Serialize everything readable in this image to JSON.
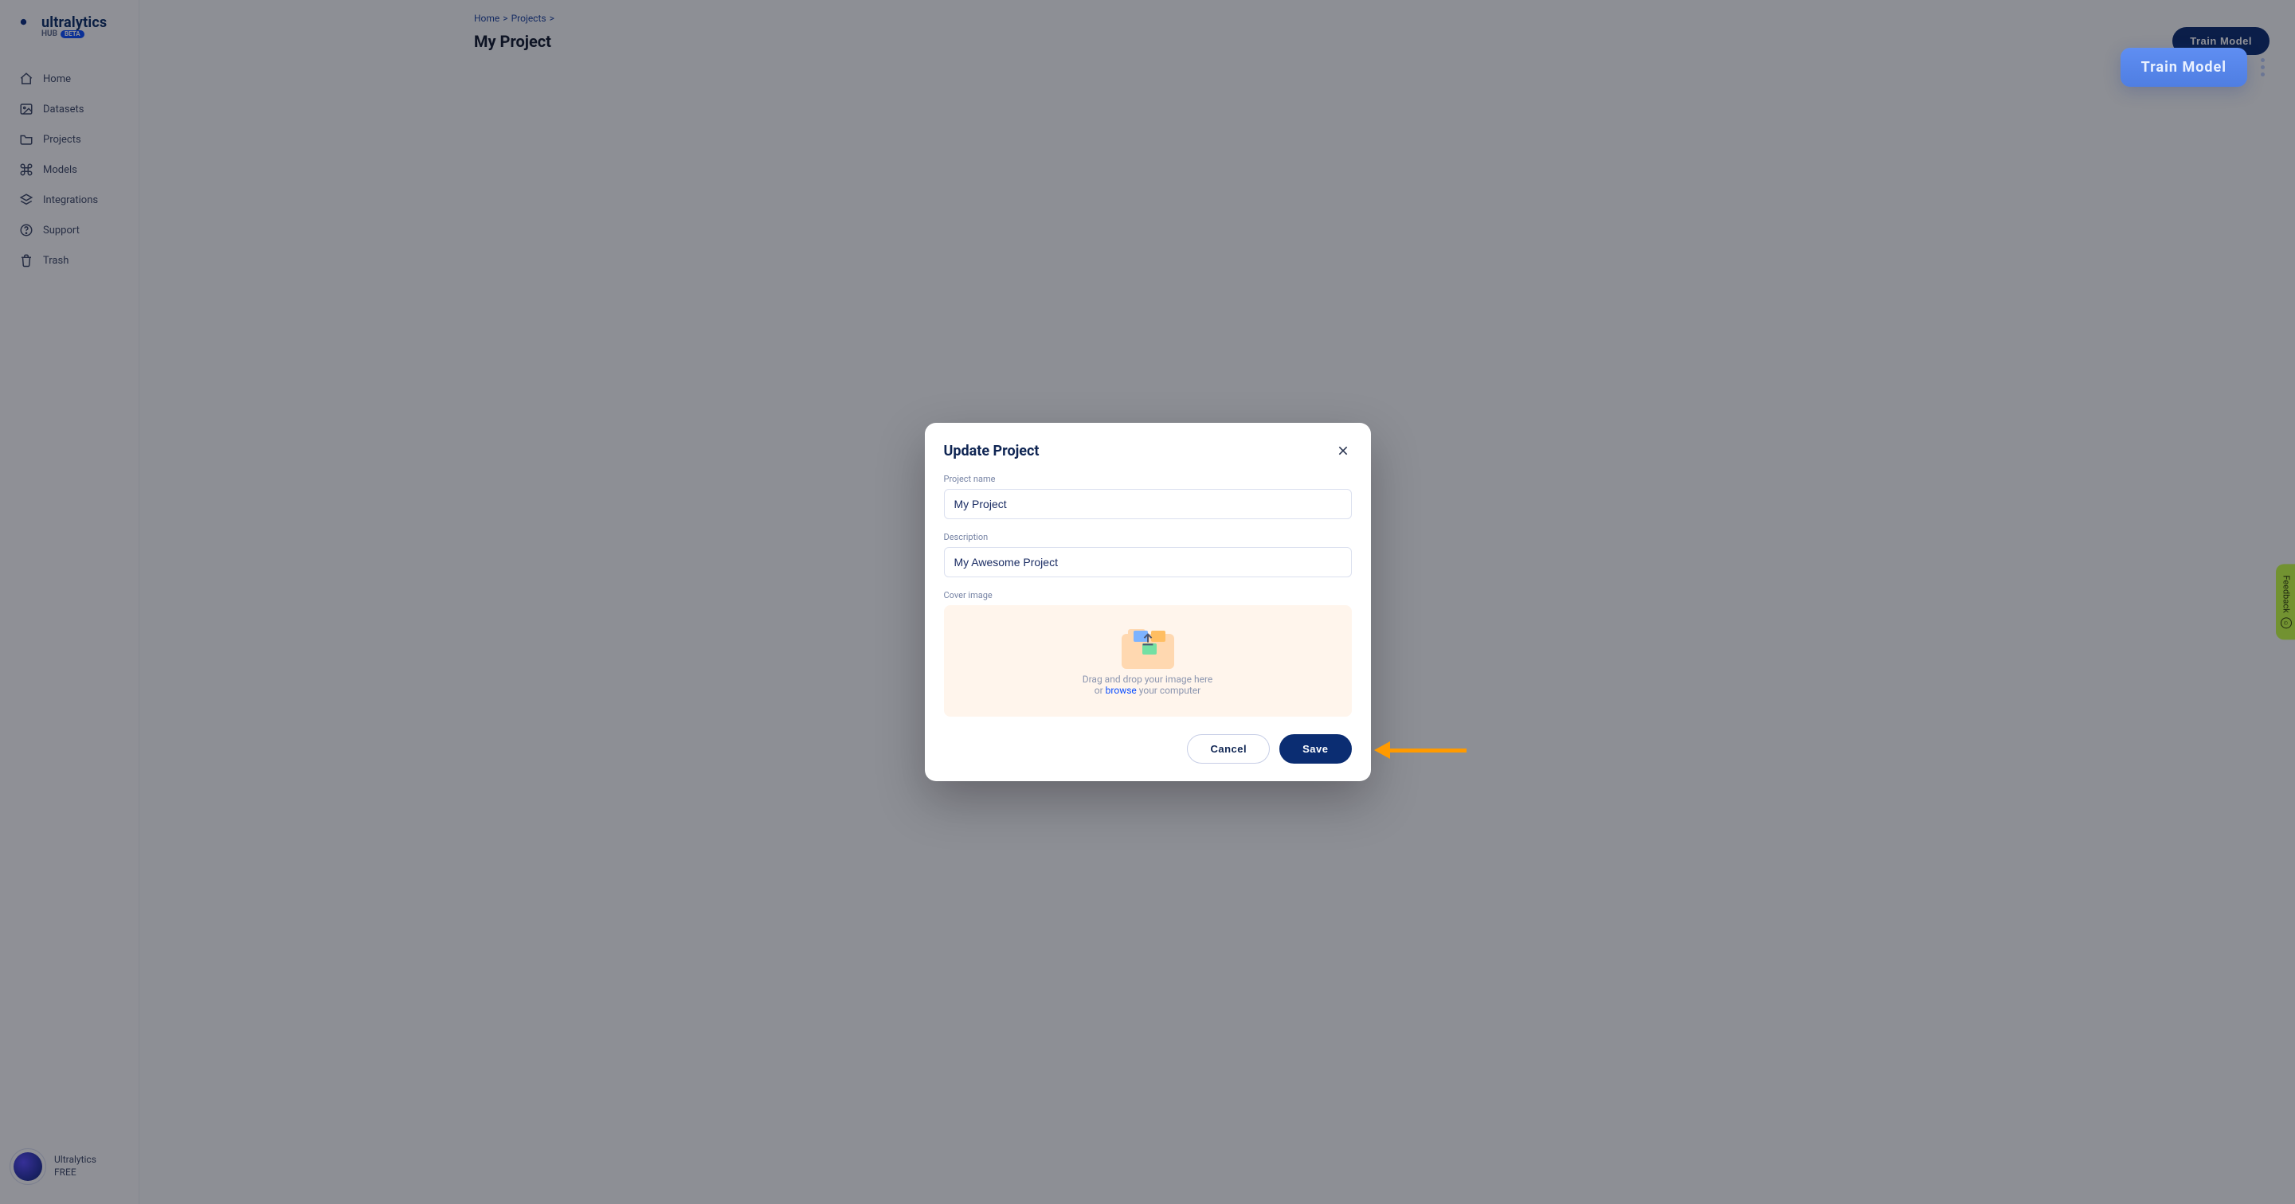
{
  "brand": {
    "name": "ultralytics",
    "sub": "HUB",
    "badge": "BETA"
  },
  "sidebar": {
    "items": [
      {
        "label": "Home",
        "icon": "home-icon"
      },
      {
        "label": "Datasets",
        "icon": "image-icon"
      },
      {
        "label": "Projects",
        "icon": "folder-icon"
      },
      {
        "label": "Models",
        "icon": "command-icon"
      },
      {
        "label": "Integrations",
        "icon": "layers-icon"
      },
      {
        "label": "Support",
        "icon": "help-icon"
      },
      {
        "label": "Trash",
        "icon": "trash-icon"
      }
    ]
  },
  "user": {
    "name": "Ultralytics",
    "plan": "FREE"
  },
  "breadcrumb": {
    "home": "Home",
    "projects": "Projects"
  },
  "page": {
    "title": "My Project",
    "train_btn": "Train Model"
  },
  "float_cta": {
    "label": "Train Model"
  },
  "feedback": {
    "label": "Feedback"
  },
  "modal": {
    "title": "Update Project",
    "fields": {
      "name": {
        "label": "Project name",
        "value": "My Project"
      },
      "desc": {
        "label": "Description",
        "value": "My Awesome Project"
      },
      "cover": {
        "label": "Cover image",
        "drop_line1": "Drag and drop your image here",
        "drop_or": "or ",
        "drop_browse": "browse",
        "drop_tail": " your computer"
      }
    },
    "actions": {
      "cancel": "Cancel",
      "save": "Save"
    }
  }
}
